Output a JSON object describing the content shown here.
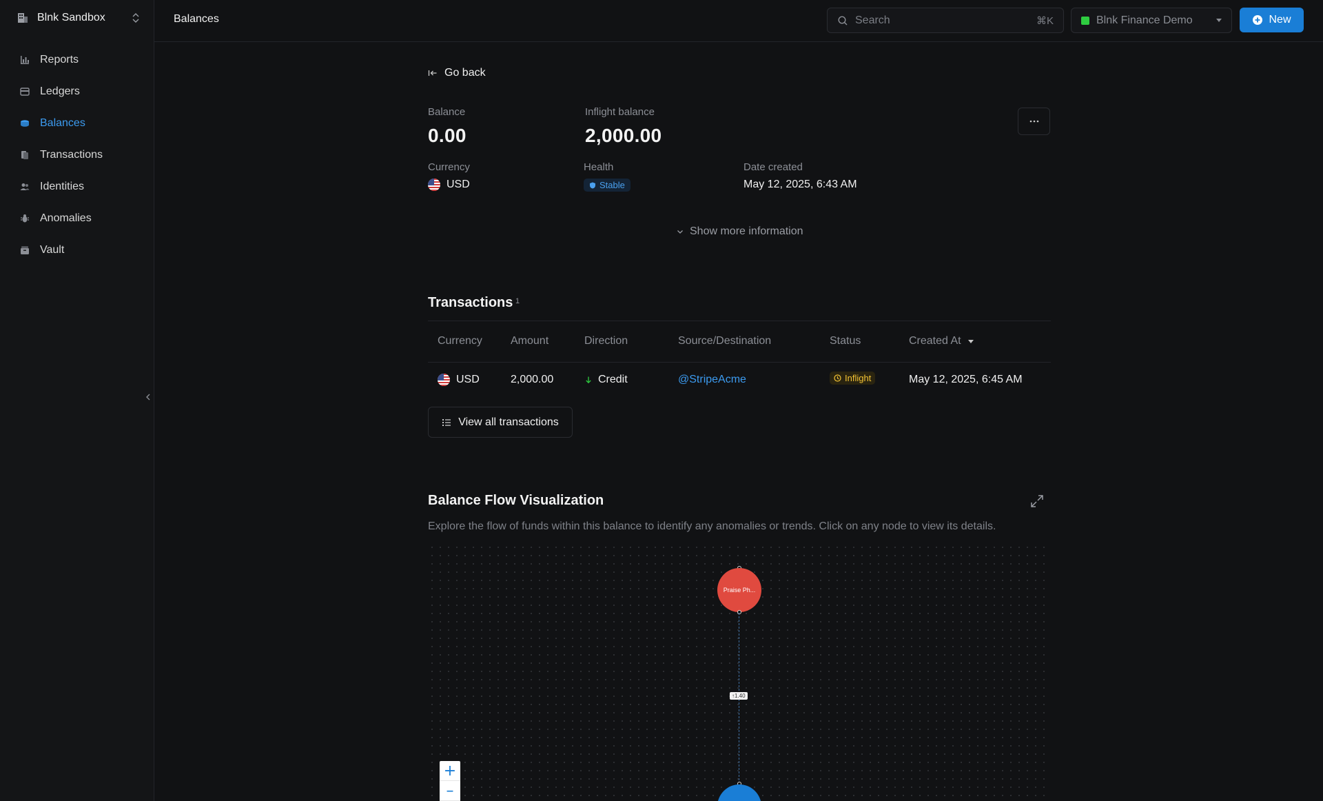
{
  "workspace": {
    "name": "Blnk Sandbox"
  },
  "sidebar": {
    "items": [
      {
        "label": "Reports",
        "icon": "bar-chart-icon"
      },
      {
        "label": "Ledgers",
        "icon": "ledger-icon"
      },
      {
        "label": "Balances",
        "icon": "coins-icon",
        "active": true
      },
      {
        "label": "Transactions",
        "icon": "transactions-icon"
      },
      {
        "label": "Identities",
        "icon": "users-icon"
      },
      {
        "label": "Anomalies",
        "icon": "bug-icon"
      },
      {
        "label": "Vault",
        "icon": "vault-icon"
      }
    ]
  },
  "header": {
    "title": "Balances",
    "search_placeholder": "Search",
    "search_shortcut": "⌘K",
    "org_name": "Blnk Finance Demo",
    "new_label": "New"
  },
  "balance": {
    "go_back": "Go back",
    "balance_label": "Balance",
    "balance_value": "0.00",
    "inflight_label": "Inflight balance",
    "inflight_value": "2,000.00",
    "currency_label": "Currency",
    "currency_value": "USD",
    "health_label": "Health",
    "health_value": "Stable",
    "date_label": "Date created",
    "date_value": "May 12, 2025, 6:43 AM",
    "show_more": "Show more information"
  },
  "transactions": {
    "title": "Transactions",
    "count": "1",
    "columns": [
      "Currency",
      "Amount",
      "Direction",
      "Source/Destination",
      "Status",
      "Created At"
    ],
    "rows": [
      {
        "currency": "USD",
        "amount": "2,000.00",
        "direction": "Credit",
        "counterparty": "@StripeAcme",
        "status": "Inflight",
        "created_at": "May 12, 2025, 6:45 AM"
      }
    ],
    "view_all": "View all transactions"
  },
  "flow": {
    "title": "Balance Flow Visualization",
    "description": "Explore the flow of funds within this balance to identify any anomalies or trends. Click on any node to view its details.",
    "source_node_label": "Praise Ph...",
    "edge_label": "↑1.40",
    "zoom_in": "+",
    "zoom_out": "–"
  },
  "colors": {
    "accent": "#1a7ed6",
    "active_link": "#3c9bf0",
    "source_node": "#e04a3f",
    "inflight": "#f3c234",
    "credit": "#2ecc40"
  }
}
